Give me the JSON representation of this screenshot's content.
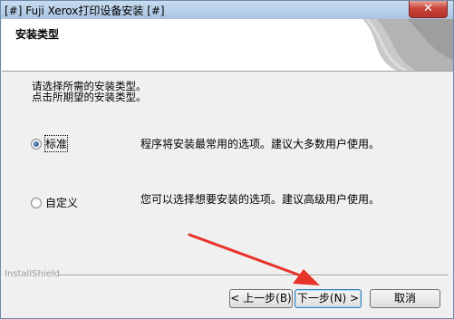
{
  "window": {
    "title": "[#] Fuji Xerox打印设备安装 [#]",
    "close_glyph": "✕"
  },
  "header": {
    "title": "安装类型"
  },
  "body": {
    "prompt_line1": "请选择所需的安装类型。",
    "prompt_line2": "点击所期望的安装类型。",
    "options": [
      {
        "label": "标准",
        "description": "程序将安装最常用的选项。建议大多数用户使用。",
        "selected": true
      },
      {
        "label": "自定义",
        "description": "您可以选择想要安装的选项。建议高级用户使用。",
        "selected": false
      }
    ]
  },
  "footer": {
    "brand": "InstallShield",
    "back_label": "< 上一步(B)",
    "next_label": "下一步(N) >",
    "cancel_label": "取消"
  },
  "colors": {
    "annotation_arrow": "#e8332a",
    "title_bar": "#b8cfe7",
    "close_button": "#c7443a"
  }
}
